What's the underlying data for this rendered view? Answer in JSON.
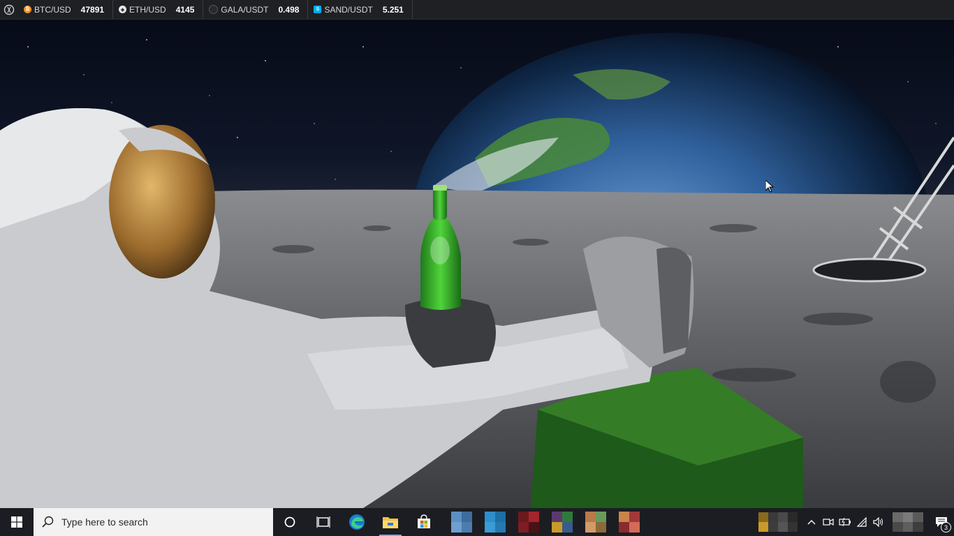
{
  "ticker": {
    "logo_icon": "exchange-logo-icon",
    "items": [
      {
        "pair": "BTC/USD",
        "price": "47891",
        "icon": "bitcoin-icon",
        "color": "#f7931a"
      },
      {
        "pair": "ETH/USD",
        "price": "4145",
        "icon": "ethereum-icon",
        "color": "#d0d0d0"
      },
      {
        "pair": "GALA/USDT",
        "price": "0.498",
        "icon": "gala-icon",
        "color": "#2a2a2a"
      },
      {
        "pair": "SAND/USDT",
        "price": "5.251",
        "icon": "sandbox-icon",
        "color": "#00adef"
      }
    ]
  },
  "wallpaper": {
    "description_icon": "desktop-wallpaper",
    "cursor_icon": "mouse-pointer-icon"
  },
  "taskbar": {
    "start_icon": "windows-logo-icon",
    "search": {
      "placeholder": "Type here to search",
      "icon": "search-icon"
    },
    "pinned": [
      {
        "name": "cortana-icon"
      },
      {
        "name": "task-view-icon"
      },
      {
        "name": "edge-icon"
      },
      {
        "name": "file-explorer-icon",
        "active": true
      },
      {
        "name": "microsoft-store-icon"
      }
    ],
    "tray": {
      "icons": [
        "chevron-up-icon",
        "meet-now-icon",
        "battery-icon",
        "wifi-icon",
        "volume-icon"
      ],
      "notifications_count": "3"
    }
  },
  "colors": {
    "ticker_bg": "#1f2024",
    "taskbar_bg": "#1c1d22",
    "search_bg": "#f2f2f2",
    "active_indicator": "#7aa7e8"
  }
}
